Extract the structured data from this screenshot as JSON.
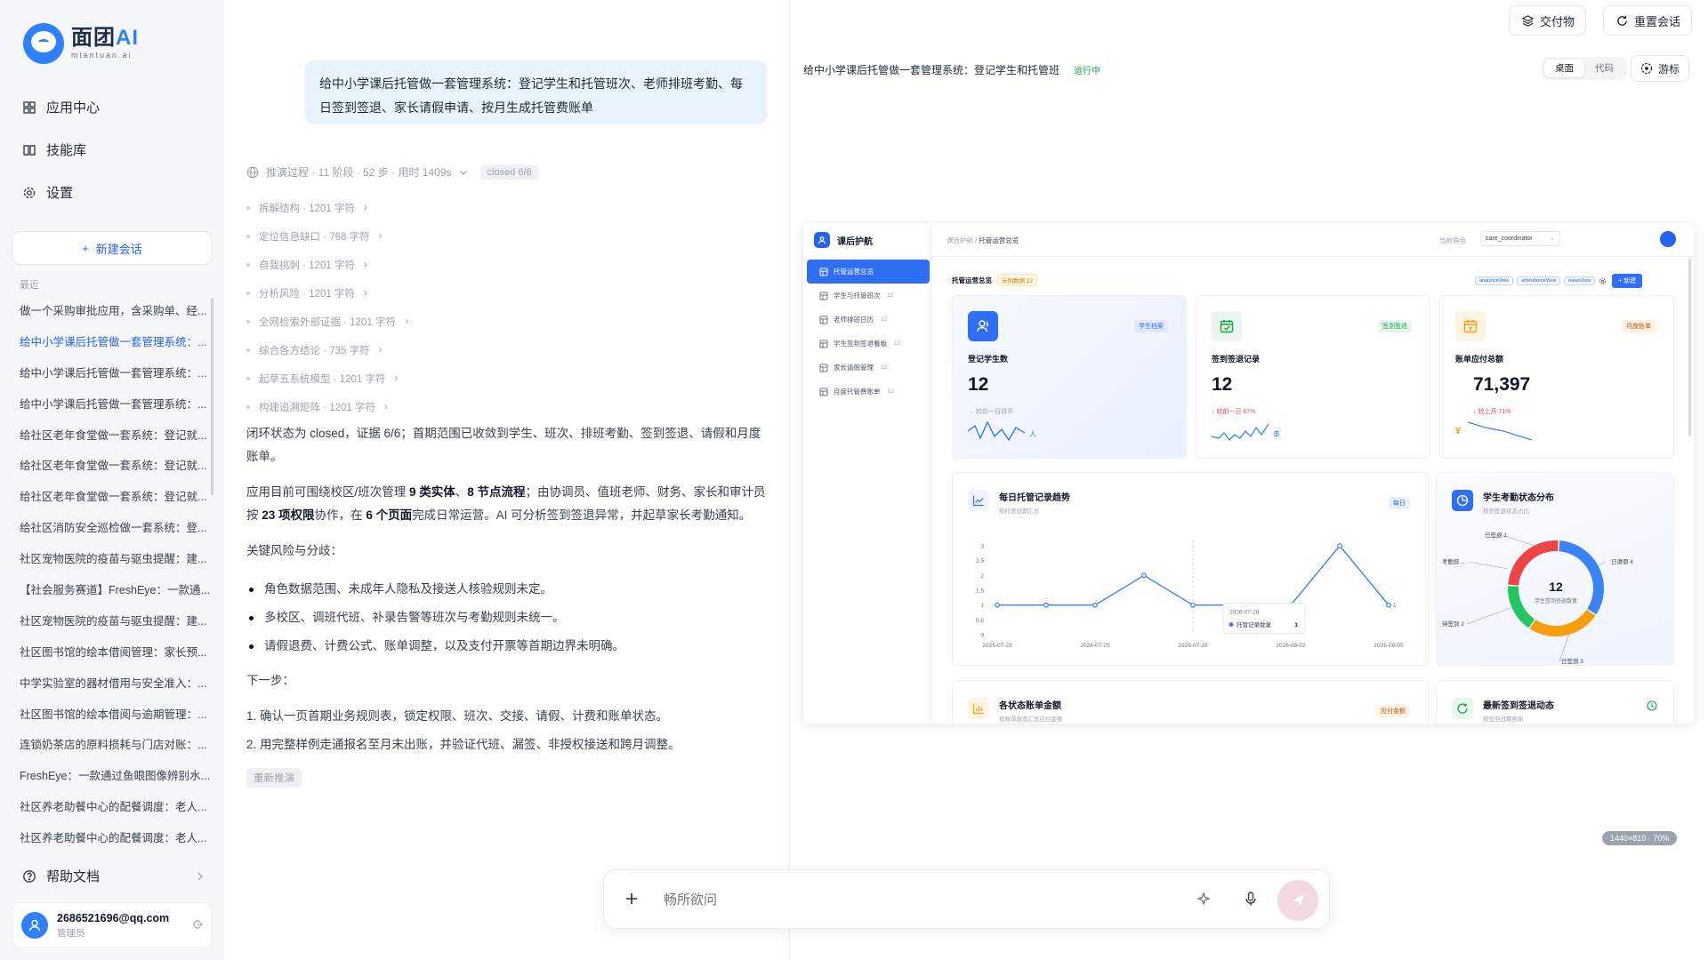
{
  "brand": {
    "name_a": "面团",
    "name_b": "AI",
    "sub": "miantuan.ai"
  },
  "nav": {
    "app_center": "应用中心",
    "skills": "技能库",
    "settings": "设置"
  },
  "new_chat": "新建会话",
  "recent_label": "最近",
  "history": [
    "做一个采购审批应用，含采购单、经...",
    "给中小学课后托管做一套管理系统：...",
    "给中小学课后托管做一套管理系统：...",
    "给中小学课后托管做一套管理系统：...",
    "给社区老年食堂做一套系统：登记就...",
    "给社区老年食堂做一套系统：登记就...",
    "给社区老年食堂做一套系统：登记就...",
    "给社区消防安全巡检做一套系统：登...",
    "社区宠物医院的疫苗与驱虫提醒：建...",
    "【社会服务赛道】FreshEye：一款通...",
    "社区宠物医院的疫苗与驱虫提醒：建...",
    "社区图书馆的绘本借阅管理：家长预...",
    "中学实验室的器材借用与安全准入：...",
    "社区图书馆的绘本借阅与逾期管理：...",
    "连锁奶茶店的原料损耗与门店对账：...",
    "FreshEye：一款通过鱼眼图像辨别水...",
    "社区养老助餐中心的配餐调度：老人...",
    "社区养老助餐中心的配餐调度：老人..."
  ],
  "help": "帮助文档",
  "user": {
    "email": "2686521696@qq.com",
    "role": "管理员"
  },
  "prompt": "给中小学课后托管做一套管理系统：登记学生和托管班次、老师排班考勤、每日签到签退、家长请假申请、按月生成托管费账单",
  "process": {
    "summary": "推演过程 · 11 阶段 · 52 步 · 用时 1409s",
    "tag": "closed 6/6"
  },
  "steps": [
    "拆解结构 · 1201 字符",
    "定位信息缺口 · 768 字符",
    "自我挑刺 · 1201 字符",
    "分析风险 · 1201 字符",
    "全网检索外部证据 · 1201 字符",
    "综合各方结论 · 735 字符",
    "起草五系统模型 · 1201 字符",
    "构建追溯矩阵 · 1201 字符"
  ],
  "answer": {
    "p1": "闭环状态为 closed，证据 6/6；首期范围已收敛到学生、班次、排班考勤、签到签退、请假和月度账单。",
    "p2_a": "应用目前可围绕校区/班次管理 ",
    "p2_b1": "9 类实体",
    "p2_c": "、",
    "p2_b2": "8 节点流程",
    "p2_d": "；由协调员、值班老师、财务、家长和审计员按 ",
    "p2_b3": "23 项权限",
    "p2_e": "协作，在 ",
    "p2_b4": "6 个页面",
    "p2_f": "完成日常运营。AI 可分析签到签退异常，并起草家长考勤通知。",
    "risks_title": "关键风险与分歧：",
    "risks": [
      "角色数据范围、未成年人隐私及接送人核验规则未定。",
      "多校区、调班代班、补录告警等班次与考勤规则未统一。",
      "请假退费、计费公式、账单调整，以及支付开票等首期边界未明确。"
    ],
    "next_title": "下一步：",
    "next": [
      "1. 确认一页首期业务规则表，锁定权限、班次、交接、请假、计费和账单状态。",
      "2. 用完整样例走通报名至月末出账，并验证代班、漏签、非授权接送和跨月调整。"
    ]
  },
  "redo": "重新推演",
  "top_buttons": {
    "deliverables": "交付物",
    "reset": "重置会话"
  },
  "preview": {
    "title": "给中小学课后托管做一套管理系统：登记学生和托管班",
    "status": "运行中",
    "mode_desktop": "桌面",
    "mode_code": "代码",
    "cursor": "游标",
    "size_badge": "1440×810 · 70%"
  },
  "app": {
    "brand": "课后护航",
    "nav": [
      {
        "label": "托管运营总览",
        "count": "",
        "icon": "grid-icon"
      },
      {
        "label": "学生与托管班次",
        "count": "12",
        "icon": "list-icon"
      },
      {
        "label": "老师排班日历",
        "count": "12",
        "icon": "edit-icon"
      },
      {
        "label": "学生签到签退看板",
        "count": "12",
        "icon": "board-icon"
      },
      {
        "label": "家长请假管理",
        "count": "12",
        "icon": "table-icon"
      },
      {
        "label": "月度托管费账单",
        "count": "12",
        "icon": "list-icon"
      }
    ],
    "crumb_parent": "课后护航",
    "crumb_sep": " / ",
    "crumb_current": "托管运营总览",
    "role_label": "当前角色",
    "role_value": "care_coordinator",
    "overview_title": "托管运营总览",
    "overview_badge": "示例数据 12",
    "view_tags": [
      "analyticsView",
      "attendanceView",
      "leaveView"
    ],
    "new_button": "+ 新建",
    "kpis": [
      {
        "tag": "学生档案",
        "label": "登记学生数",
        "value": "12",
        "trend": "→ 较前一日持平",
        "unit": "人"
      },
      {
        "tag": "签到签退",
        "label": "签到签退记录",
        "value": "12",
        "trend": "↓ 较前一日 67%",
        "unit": "条"
      },
      {
        "tag": "月度账单",
        "label": "账单应付总额",
        "value": "71,397",
        "trend": "↓ 较上月 71%",
        "unit": "¥"
      }
    ],
    "trend_panel": {
      "title": "每日托管记录趋势",
      "sub": "按托管日期汇总",
      "tag": "每日"
    },
    "donut_panel": {
      "title": "学生考勤状态分布",
      "sub": "按到签退状态占比",
      "center_value": "12",
      "center_label": "学生签到签退数量"
    },
    "bill_panel": {
      "title": "各状态账单金额",
      "sub": "按账单状态汇总应付金额",
      "tag": "应付金额"
    },
    "latest_panel": {
      "title": "最新签到签退动态",
      "sub": "按签到日期更新"
    }
  },
  "chart_data": [
    {
      "type": "line",
      "x": [
        "2026-07-23",
        "2026-07-24",
        "2026-07-25",
        "2026-07-26",
        "2026-07-28",
        "2026-07-31",
        "2026-08-02",
        "2026-08-04",
        "2026-08-05"
      ],
      "xticks": [
        "2026-07-23",
        "2026-07-25",
        "2026-07-28",
        "2026-08-02",
        "2026-08-05"
      ],
      "series": [
        {
          "name": "托管记录数量",
          "values": [
            1,
            1,
            1,
            2,
            1,
            1,
            1,
            3,
            1
          ]
        }
      ],
      "ylim": [
        0,
        3
      ],
      "yticks": [
        "0",
        "0.5",
        "1",
        "1.5",
        "2",
        "2.5",
        "3"
      ],
      "last_label": "1",
      "tooltip": {
        "date": "2026-07-28",
        "series": "托管记录数量",
        "value": "1"
      },
      "color": "#3b82f6"
    },
    {
      "type": "pie",
      "categories": [
        "已请假",
        "已签到",
        "待签到",
        "考勤异常"
      ],
      "values": [
        4,
        3,
        2,
        3
      ],
      "colors": [
        "#3b82f6",
        "#f59e0b",
        "#22c55e",
        "#ef4444"
      ],
      "labels": [
        "已请假 4",
        "已签到 3",
        "待签到 2",
        "考勤异…",
        "已签退 1"
      ]
    }
  ]
}
